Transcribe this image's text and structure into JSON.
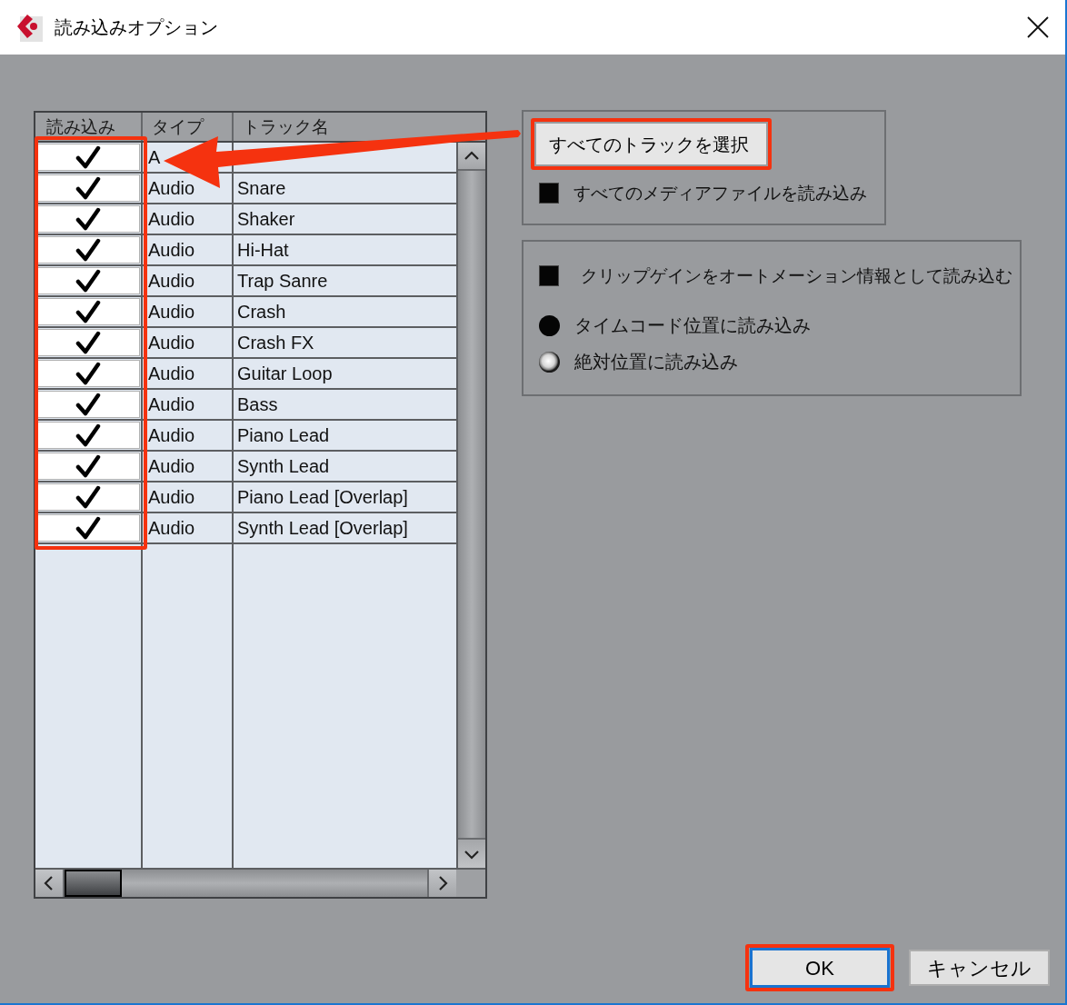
{
  "window": {
    "title": "読み込みオプション"
  },
  "table": {
    "columns": [
      {
        "label": "読み込み",
        "highlighted": true
      },
      {
        "label": "タイプ",
        "highlighted": false
      },
      {
        "label": "トラック名",
        "highlighted": false
      }
    ],
    "rows": [
      {
        "checked": true,
        "type": "A"
      },
      {
        "checked": true,
        "type": "Audio",
        "name": "Snare"
      },
      {
        "checked": true,
        "type": "Audio",
        "name": "Shaker"
      },
      {
        "checked": true,
        "type": "Audio",
        "name": "Hi-Hat"
      },
      {
        "checked": true,
        "type": "Audio",
        "name": "Trap Sanre"
      },
      {
        "checked": true,
        "type": "Audio",
        "name": "Crash"
      },
      {
        "checked": true,
        "type": "Audio",
        "name": "Crash FX"
      },
      {
        "checked": true,
        "type": "Audio",
        "name": "Guitar Loop"
      },
      {
        "checked": true,
        "type": "Audio",
        "name": "Bass"
      },
      {
        "checked": true,
        "type": "Audio",
        "name": "Piano Lead"
      },
      {
        "checked": true,
        "type": "Audio",
        "name": "Synth Lead"
      },
      {
        "checked": true,
        "type": "Audio",
        "name": "Piano Lead [Overlap]"
      },
      {
        "checked": true,
        "type": "Audio",
        "name": "Synth Lead [Overlap]"
      }
    ]
  },
  "track_panel": {
    "select_all_button": {
      "label": "すべてのトラックを選択",
      "highlighted": true
    },
    "import_all_media": {
      "label": "すべてのメディアファイルを読み込み",
      "checked": false
    }
  },
  "position_panel": {
    "clip_gain": {
      "label": "クリップゲインをオートメーション情報として読み込む",
      "checked": false
    },
    "radios": [
      {
        "label": "タイムコード位置に読み込み",
        "selected": false
      },
      {
        "label": "絶対位置に読み込み",
        "selected": true
      }
    ]
  },
  "buttons": [
    {
      "label": "OK",
      "focused": true,
      "highlighted": true
    },
    {
      "label": "キャンセル",
      "focused": false,
      "highlighted": false
    }
  ],
  "callout_arrow": true
}
